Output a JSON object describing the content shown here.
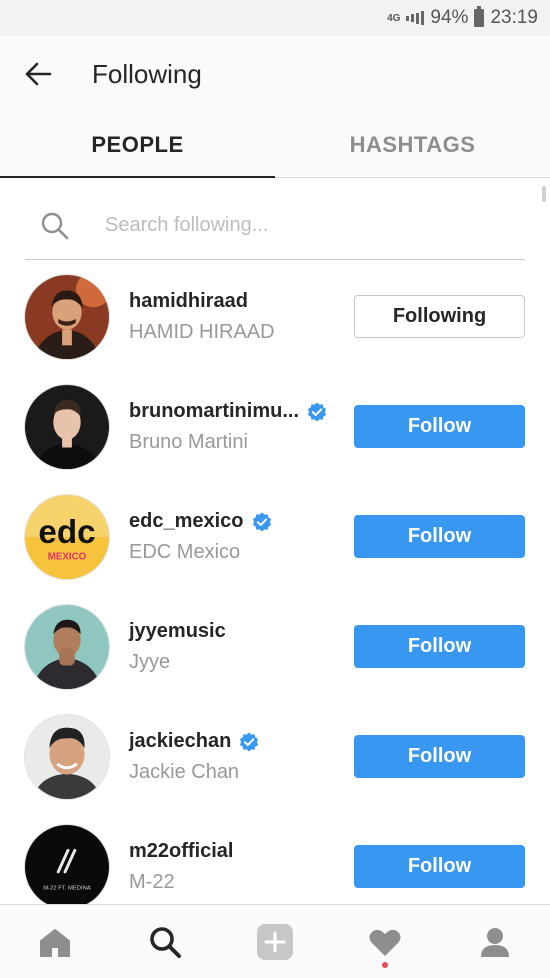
{
  "status_bar": {
    "network": "4G",
    "battery": "94%",
    "time": "23:19"
  },
  "header": {
    "title": "Following",
    "back_icon": "arrow-left-icon"
  },
  "tabs": [
    {
      "label": "PEOPLE",
      "active": true
    },
    {
      "label": "HASHTAGS",
      "active": false
    }
  ],
  "search": {
    "placeholder": "Search following...",
    "value": ""
  },
  "people": [
    {
      "username": "hamidhiraad",
      "fullname": "HAMID HIRAAD",
      "verified": false,
      "button": "Following"
    },
    {
      "username": "brunomartinimu...",
      "fullname": "Bruno Martini",
      "verified": true,
      "button": "Follow"
    },
    {
      "username": "edc_mexico",
      "fullname": "EDC Mexico",
      "verified": true,
      "button": "Follow"
    },
    {
      "username": "jyyemusic",
      "fullname": "Jyye",
      "verified": false,
      "button": "Follow"
    },
    {
      "username": "jackiechan",
      "fullname": "Jackie Chan",
      "verified": true,
      "button": "Follow"
    },
    {
      "username": "m22official",
      "fullname": "M-22",
      "verified": false,
      "button": "Follow"
    }
  ],
  "avatars": {
    "edc_logo": "edc",
    "edc_sub": "MEXICO",
    "m22_caption": "M-22 FT. MEDINA"
  },
  "colors": {
    "follow_button": "#3897f0",
    "verified_badge": "#3897f0",
    "notification_dot": "#ed4956"
  },
  "bottom_nav": [
    {
      "icon": "home-icon"
    },
    {
      "icon": "search-icon",
      "active": true
    },
    {
      "icon": "add-post-icon"
    },
    {
      "icon": "heart-icon",
      "has_notification": true
    },
    {
      "icon": "profile-icon"
    }
  ]
}
